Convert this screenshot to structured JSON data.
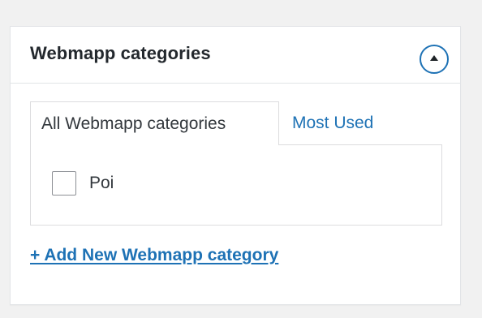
{
  "metabox": {
    "title": "Webmapp categories",
    "toggle_icon": "arrow-up-icon"
  },
  "tabs": [
    {
      "label": "All Webmapp categories",
      "active": true
    },
    {
      "label": "Most Used",
      "active": false
    }
  ],
  "categories": [
    {
      "label": "Poi",
      "checked": false
    }
  ],
  "add_new": {
    "label": "+ Add New Webmapp category"
  },
  "colors": {
    "link": "#1e72b5",
    "border": "#dcdcde",
    "background": "#f1f1f1",
    "panel": "#ffffff",
    "text": "#23282d"
  }
}
